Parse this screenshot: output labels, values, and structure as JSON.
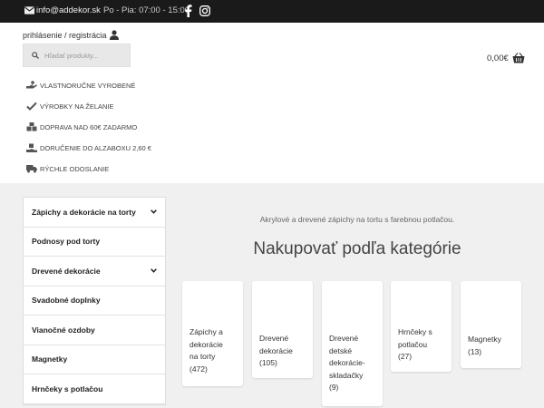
{
  "topbar": {
    "email": "info@addekor.sk",
    "hours": "Po - Pia: 07:00 - 15:00",
    "social": [
      "facebook-icon",
      "instagram-icon"
    ]
  },
  "header": {
    "login_label": "prihlásenie / registrácia",
    "search_placeholder": "Hľadať produkty...",
    "cart_total": "0,00€"
  },
  "features": [
    {
      "icon": "hand-icon",
      "label": "VLASTNORUČNE VYROBENÉ"
    },
    {
      "icon": "check-icon",
      "label": "VÝROBKY NA ŽELANIE"
    },
    {
      "icon": "boxes-icon",
      "label": "DOPRAVA NAD 60€ ZADARMO"
    },
    {
      "icon": "delivery-icon",
      "label": "DORUČENIE DO ALZABOXU 2,60 €"
    },
    {
      "icon": "truck-icon",
      "label": "RÝCHLE ODOSLANIE"
    }
  ],
  "sidebar": {
    "items": [
      {
        "label": "Zápichy a dekorácie na torty",
        "has_children": true
      },
      {
        "label": "Podnosy pod torty",
        "has_children": false
      },
      {
        "label": "Drevené dekorácie",
        "has_children": true
      },
      {
        "label": "Svadobné doplnky",
        "has_children": false
      },
      {
        "label": "Vianočné ozdoby",
        "has_children": false
      },
      {
        "label": "Magnetky",
        "has_children": false
      },
      {
        "label": "Hrnčeky s potlačou",
        "has_children": false
      }
    ]
  },
  "main": {
    "tagline": "Akrylové a drevené zápichy na tortu s farebnou potlačou.",
    "section_title": "Nakupovať podľa kategórie",
    "categories": [
      {
        "name_lines": [
          "Zápichy a",
          "dekorácie",
          "na torty",
          "(472)"
        ]
      },
      {
        "name_lines": [
          "Drevené",
          "dekorácie",
          "(105)"
        ]
      },
      {
        "name_lines": [
          "Drevené",
          "detské",
          "dekorácie-",
          "skladačky",
          "(9)"
        ]
      },
      {
        "name_lines": [
          "Hrnčeky s",
          "potlačou",
          "(27)"
        ]
      },
      {
        "name_lines": [
          "Magnetky",
          "(13)"
        ]
      }
    ]
  },
  "colors": {
    "topbar_bg": "#1a1a1a",
    "main_bg": "#f0f0f0"
  }
}
